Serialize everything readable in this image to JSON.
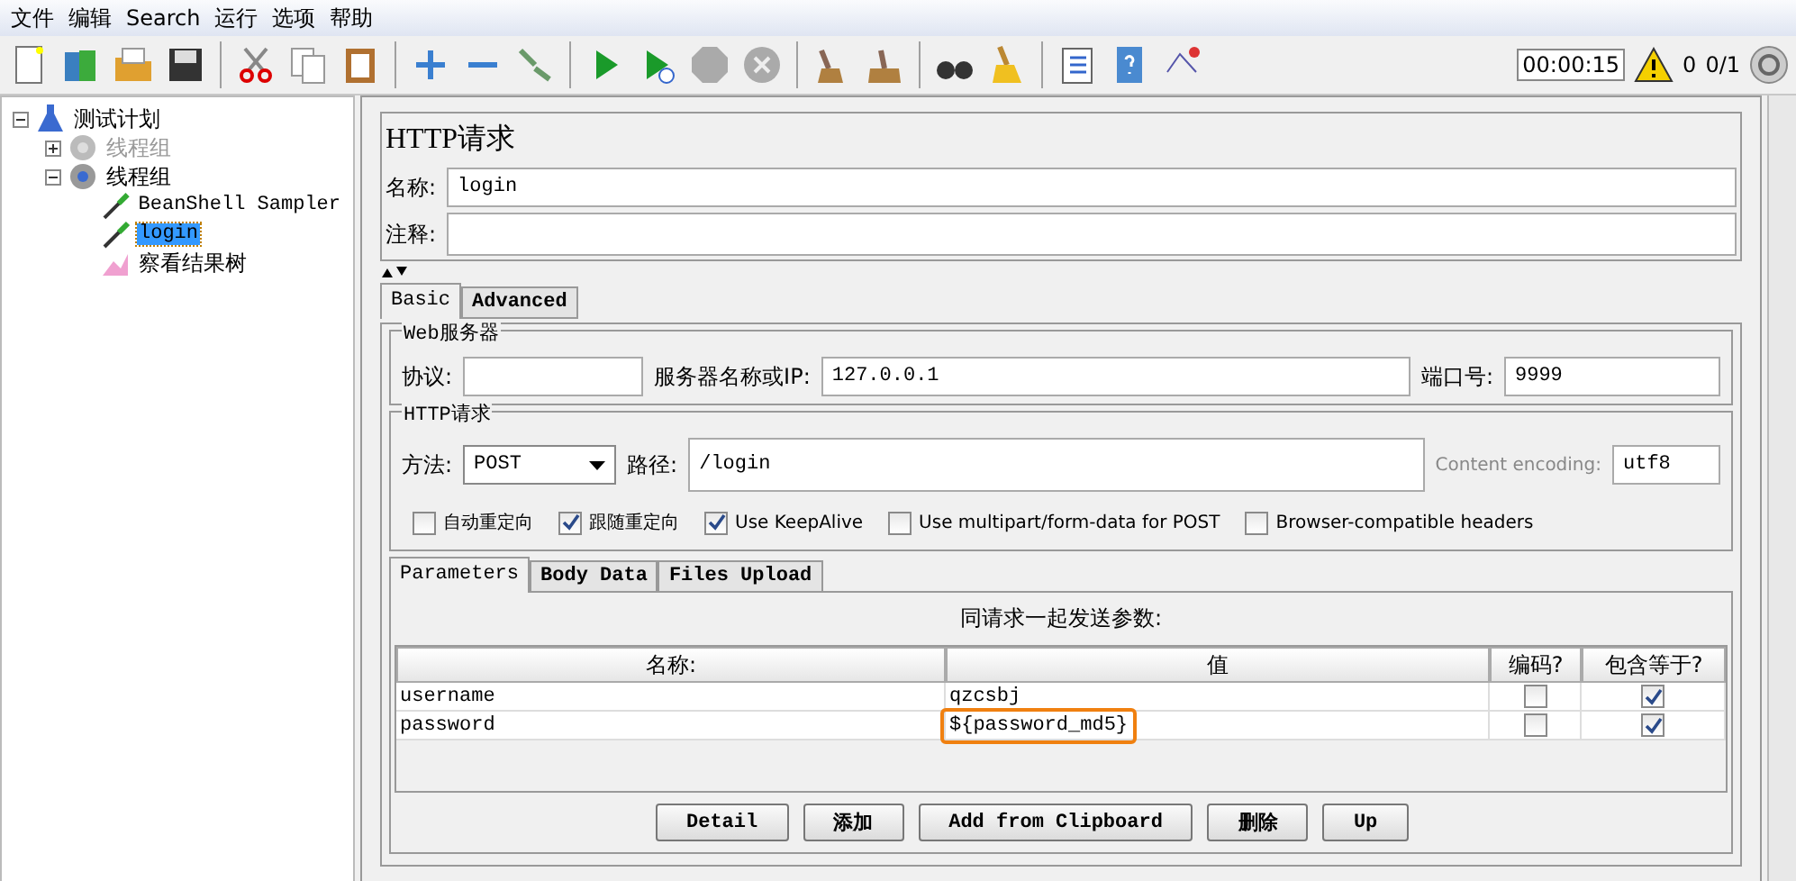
{
  "menu": [
    {
      "label": "文件"
    },
    {
      "label": "编辑"
    },
    {
      "label": "Search"
    },
    {
      "label": "运行"
    },
    {
      "label": "选项"
    },
    {
      "label": "帮助"
    }
  ],
  "status": {
    "timer": "00:00:15",
    "warnings": "0",
    "threads": "0/1"
  },
  "tree": [
    {
      "label": "测试计划",
      "kind": "plan",
      "expanded": true,
      "selected": false,
      "disabled": false,
      "children": [
        {
          "label": "线程组",
          "kind": "thread-group",
          "expanded": false,
          "selected": false,
          "disabled": true
        },
        {
          "label": "线程组",
          "kind": "thread-group",
          "expanded": true,
          "selected": false,
          "disabled": false,
          "children": [
            {
              "label": "BeanShell Sampler",
              "kind": "sampler",
              "selected": false,
              "disabled": false
            },
            {
              "label": "login",
              "kind": "sampler",
              "selected": true,
              "disabled": false
            },
            {
              "label": "察看结果树",
              "kind": "listener",
              "selected": false,
              "disabled": false
            }
          ]
        }
      ]
    }
  ],
  "editor": {
    "title": "HTTP请求",
    "name_label": "名称:",
    "name": "login",
    "comment_label": "注释:",
    "tabs": [
      {
        "label": "Basic",
        "selected": true
      },
      {
        "label": "Advanced",
        "selected": false
      }
    ],
    "web_server": {
      "legend": "Web服务器",
      "protocol_label": "协议:",
      "server_label": "服务器名称或IP:",
      "server": "127.0.0.1",
      "port_label": "端口号:",
      "port": "9999"
    },
    "http_request": {
      "legend": "HTTP请求",
      "method_label": "方法:",
      "method": "POST",
      "path_label": "路径:",
      "path": "/login",
      "encoding_label": "Content encoding:",
      "encoding": "utf8"
    },
    "options": [
      {
        "label": "自动重定向",
        "checked": false
      },
      {
        "label": "跟随重定向",
        "checked": true
      },
      {
        "label": "Use KeepAlive",
        "checked": true
      },
      {
        "label": "Use multipart/form-data for POST",
        "checked": false
      },
      {
        "label": "Browser-compatible headers",
        "checked": false
      }
    ],
    "param_tabs": [
      {
        "label": "Parameters",
        "selected": true
      },
      {
        "label": "Body Data",
        "selected": false
      },
      {
        "label": "Files Upload",
        "selected": false
      }
    ],
    "params": {
      "caption": "同请求一起发送参数:",
      "columns": [
        "名称:",
        "值",
        "编码?",
        "包含等于?"
      ],
      "rows": [
        {
          "name": "username",
          "value": "qzcsbj",
          "encode": false,
          "include_equals": true,
          "highlighted": false
        },
        {
          "name": "password",
          "value": "${password_md5}",
          "encode": false,
          "include_equals": true,
          "highlighted": true
        }
      ]
    },
    "buttons": [
      "Detail",
      "添加",
      "Add from Clipboard",
      "删除",
      "Up"
    ]
  }
}
